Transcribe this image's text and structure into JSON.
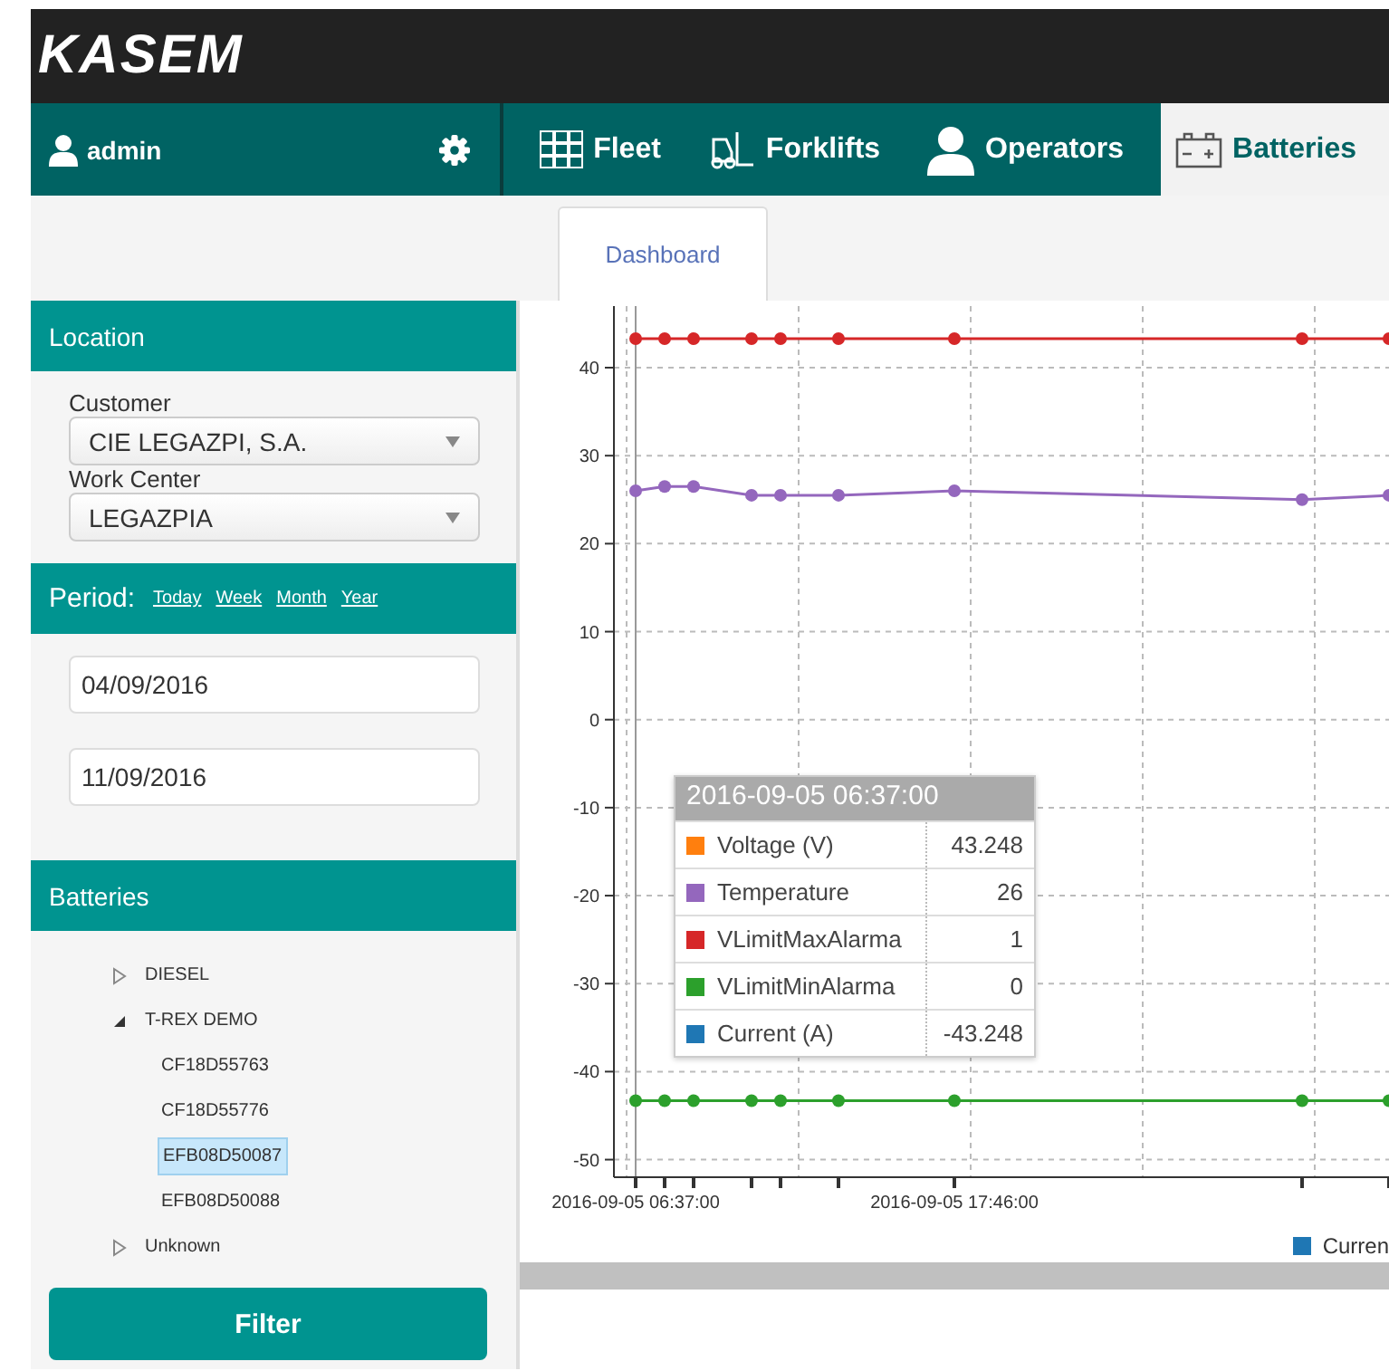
{
  "header": {
    "logo": "KASEM"
  },
  "nav": {
    "user": "admin",
    "tabs": [
      {
        "label": "Fleet",
        "kind": "fleet",
        "selected": false
      },
      {
        "label": "Forklifts",
        "kind": "forklift",
        "selected": false
      },
      {
        "label": "Operators",
        "kind": "operator",
        "selected": false
      },
      {
        "label": "Batteries",
        "kind": "battery",
        "selected": true
      }
    ]
  },
  "subtabs": [
    {
      "label": "Dashboard",
      "selected": true
    }
  ],
  "sidebar": {
    "location": {
      "title": "Location",
      "customer_label": "Customer",
      "customer": "CIE LEGAZPI, S.A.",
      "work_center_label": "Work Center",
      "work_center": "LEGAZPIA"
    },
    "period": {
      "title": "Period:",
      "links": [
        "Today",
        "Week",
        "Month",
        "Year"
      ],
      "from": "04/09/2016",
      "to": "11/09/2016"
    },
    "batteries": {
      "title": "Batteries",
      "tree": [
        {
          "label": "DIESEL",
          "expanded": false
        },
        {
          "label": "T-REX DEMO",
          "expanded": true,
          "children": [
            {
              "label": "CF18D55763",
              "selected": false
            },
            {
              "label": "CF18D55776",
              "selected": false
            },
            {
              "label": "EFB08D50087",
              "selected": true
            },
            {
              "label": "EFB08D50088",
              "selected": false
            }
          ]
        },
        {
          "label": "Unknown",
          "expanded": false
        }
      ]
    },
    "filter_button": "Filter"
  },
  "chart": {
    "chart_data": {
      "type": "line",
      "grid": true,
      "categories": [
        "2016-09-05 06:37:00",
        null,
        null,
        null,
        null,
        null,
        null,
        null,
        null,
        null,
        null,
        "2016-09-05 17:46:00",
        null,
        null,
        null,
        null,
        null,
        null,
        null,
        null,
        null,
        null,
        null,
        null,
        null,
        null,
        null
      ],
      "series": [
        {
          "color": "#d62728",
          "marker": "circle",
          "values": [
            43.3,
            43.3,
            43.3,
            null,
            43.3,
            43.3,
            null,
            43.3,
            null,
            null,
            null,
            43.3,
            null,
            null,
            null,
            null,
            null,
            null,
            null,
            null,
            null,
            null,
            null,
            43.3,
            null,
            null,
            43.3
          ]
        },
        {
          "color": "#9467bd",
          "marker": "circle",
          "values": [
            26,
            26.5,
            26.5,
            null,
            25.5,
            25.5,
            null,
            25.5,
            null,
            null,
            null,
            26,
            null,
            null,
            null,
            null,
            null,
            null,
            null,
            null,
            null,
            null,
            null,
            25,
            null,
            null,
            25.5
          ]
        },
        {
          "color": "#2ca02c",
          "marker": "circle",
          "values": [
            -43.3,
            -43.3,
            -43.3,
            null,
            -43.3,
            -43.3,
            null,
            -43.3,
            null,
            null,
            null,
            -43.3,
            null,
            null,
            null,
            null,
            null,
            null,
            null,
            null,
            null,
            null,
            null,
            -43.3,
            null,
            null,
            -43.3
          ]
        }
      ],
      "ylim": [
        -52,
        47
      ],
      "yticks": [
        -50,
        -40,
        -30,
        -20,
        -10,
        0,
        10,
        20,
        30,
        40
      ]
    },
    "tooltip": {
      "title": "2016-09-05 06:37:00",
      "rows": [
        {
          "name": "Voltage (V)",
          "color": "#ff7f0e",
          "value": "43.248"
        },
        {
          "name": "Temperature",
          "color": "#9467bd",
          "value": "26"
        },
        {
          "name": "VLimitMaxAlarma",
          "color": "#d62728",
          "value": "1"
        },
        {
          "name": "VLimitMinAlarma",
          "color": "#2ca02c",
          "value": "0"
        },
        {
          "name": "Current (A)",
          "color": "#1f77b4",
          "value": "-43.248"
        }
      ]
    },
    "legend": [
      {
        "name": "Curren",
        "color": "#1f77b4"
      }
    ]
  }
}
